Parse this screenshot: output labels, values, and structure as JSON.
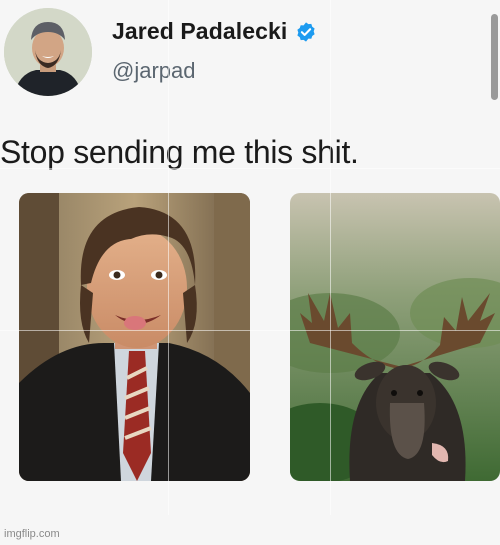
{
  "tweet": {
    "display_name": "Jared Padalecki",
    "handle": "@jarpad",
    "text": "Stop sending me this shit."
  },
  "icons": {
    "verified": "verified-badge-icon",
    "avatar": "profile-avatar"
  },
  "colors": {
    "verified_blue": "#1d9bf0",
    "name": "#1a1a1a",
    "handle": "#5b6670"
  },
  "watermark": "imgflip.com"
}
